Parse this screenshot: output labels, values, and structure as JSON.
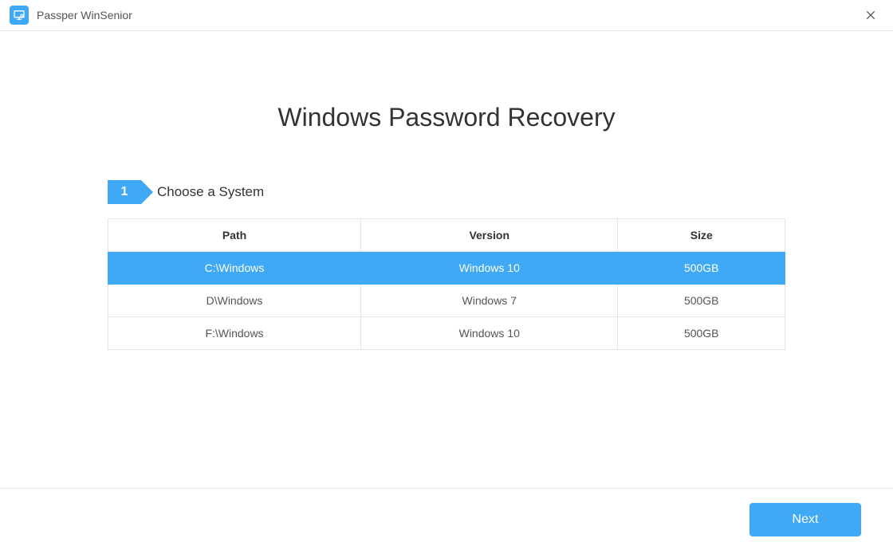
{
  "app": {
    "title": "Passper WinSenior"
  },
  "page": {
    "title": "Windows Password Recovery"
  },
  "step": {
    "number": "1",
    "label": "Choose a System"
  },
  "table": {
    "headers": {
      "path": "Path",
      "version": "Version",
      "size": "Size"
    },
    "rows": [
      {
        "path": "C:\\Windows",
        "version": "Windows 10",
        "size": "500GB",
        "selected": true
      },
      {
        "path": "D\\Windows",
        "version": "Windows 7",
        "size": "500GB",
        "selected": false
      },
      {
        "path": "F:\\Windows",
        "version": "Windows 10",
        "size": "500GB",
        "selected": false
      }
    ]
  },
  "footer": {
    "next_label": "Next"
  },
  "colors": {
    "accent": "#3fa9f5"
  }
}
